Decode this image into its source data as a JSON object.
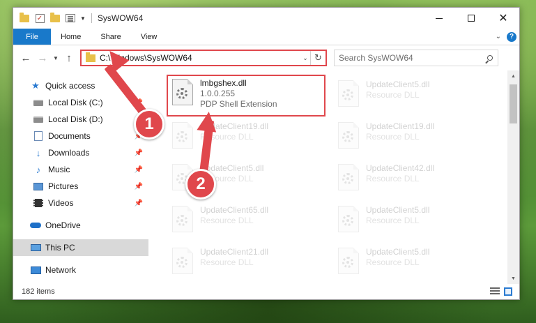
{
  "window": {
    "title": "SysWOW64",
    "controls": {
      "minimize": "—",
      "maximize": "☐",
      "close": "✕"
    }
  },
  "ribbon": {
    "tabs": [
      "File",
      "Home",
      "Share",
      "View"
    ],
    "help": "?"
  },
  "navigation": {
    "back": "←",
    "forward": "→",
    "recent": "⌄",
    "up": "↑",
    "address": "C:\\Windows\\SysWOW64",
    "refresh": "↻",
    "search_placeholder": "Search SysWOW64"
  },
  "sidebar": {
    "quick_access": "Quick access",
    "items": [
      {
        "label": "Local Disk (C:)",
        "icon": "disk-icon"
      },
      {
        "label": "Local Disk (D:)",
        "icon": "disk-icon"
      },
      {
        "label": "Documents",
        "icon": "documents-icon",
        "pinned": true
      },
      {
        "label": "Downloads",
        "icon": "download-icon",
        "pinned": true
      },
      {
        "label": "Music",
        "icon": "music-icon",
        "pinned": true
      },
      {
        "label": "Pictures",
        "icon": "pictures-icon",
        "pinned": true
      },
      {
        "label": "Videos",
        "icon": "videos-icon",
        "pinned": true
      }
    ],
    "onedrive": "OneDrive",
    "this_pc": "This PC",
    "network": "Network"
  },
  "files": {
    "highlighted": {
      "name": "lmbgshex.dll",
      "version": "1.0.0.255",
      "type": "PDP Shell Extension"
    },
    "left_column": [
      {
        "name": "UpdateClient19.dll",
        "type": "Resource DLL"
      },
      {
        "name": "UpdateClient5.dll",
        "type": "Resource DLL"
      },
      {
        "name": "UpdateClient65.dll",
        "type": "Resource DLL"
      },
      {
        "name": "UpdateClient21.dll",
        "type": "Resource DLL"
      }
    ],
    "right_column": [
      {
        "name": "UpdateClient5.dll",
        "type": "Resource DLL"
      },
      {
        "name": "UpdateClient19.dll",
        "type": "Resource DLL"
      },
      {
        "name": "UpdateClient42.dll",
        "type": "Resource DLL"
      },
      {
        "name": "UpdateClient5.dll",
        "type": "Resource DLL"
      },
      {
        "name": "UpdateClient5.dll",
        "type": "Resource DLL"
      }
    ]
  },
  "status": {
    "item_count": "182 items"
  },
  "callouts": {
    "step1": "1",
    "step2": "2"
  },
  "colors": {
    "accent": "#1979ca",
    "callout": "#e0474c",
    "selected": "#d9d9d9"
  }
}
